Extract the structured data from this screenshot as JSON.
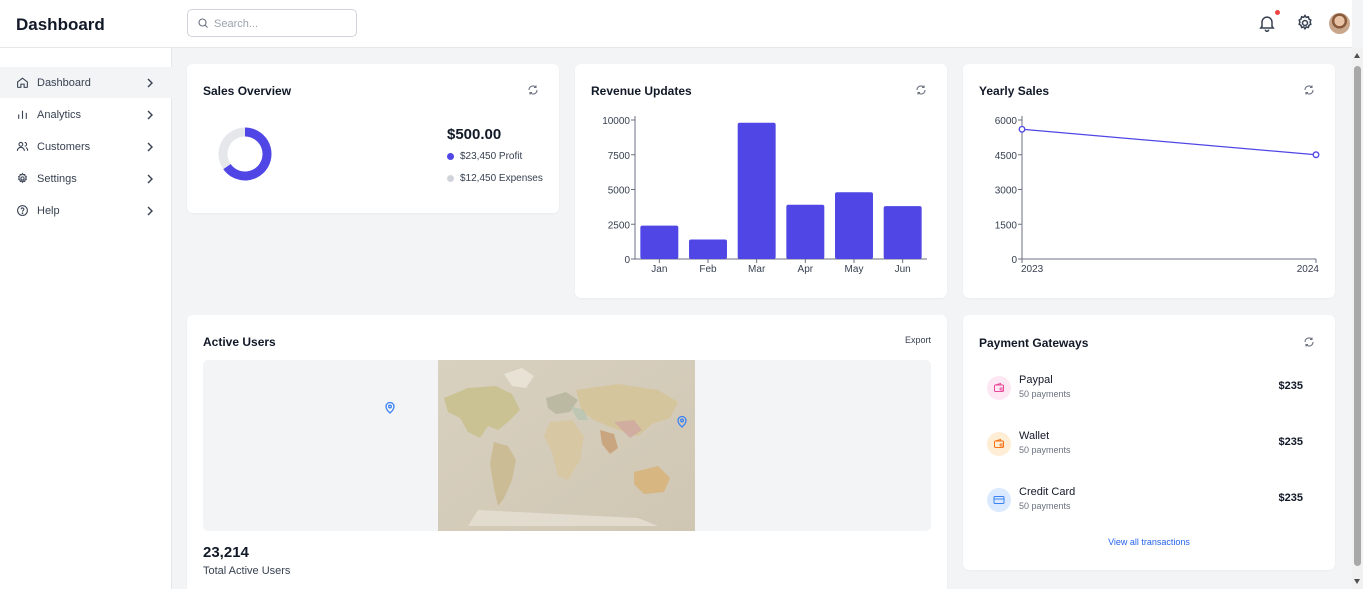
{
  "header": {
    "title": "Dashboard",
    "search_placeholder": "Search..."
  },
  "sidebar": {
    "items": [
      {
        "label": "Dashboard",
        "icon": "home-icon",
        "active": true
      },
      {
        "label": "Analytics",
        "icon": "bar-chart-icon"
      },
      {
        "label": "Customers",
        "icon": "users-icon"
      },
      {
        "label": "Settings",
        "icon": "gear-icon"
      },
      {
        "label": "Help",
        "icon": "help-circle-icon"
      }
    ]
  },
  "colors": {
    "accent": "#4f46e5",
    "profit": "#4f46e5",
    "expenses": "#e5e7eb",
    "notification_dot": "#ef4444",
    "link": "#2563eb"
  },
  "sales_overview": {
    "title": "Sales Overview",
    "amount": "$500.00",
    "profit_label": "$23,450 Profit",
    "expenses_label": "$12,450 Expenses"
  },
  "revenue_updates": {
    "title": "Revenue Updates"
  },
  "yearly_sales": {
    "title": "Yearly Sales"
  },
  "active_users": {
    "title": "Active Users",
    "export_label": "Export",
    "count": "23,214",
    "count_label": "Total Active Users"
  },
  "payment_gateways": {
    "title": "Payment Gateways",
    "items": [
      {
        "name": "Paypal",
        "sub": "50 payments",
        "amount": "$235",
        "icon": "wallet-icon",
        "icon_color": "#ec4899",
        "bg_color": "#fce7f3"
      },
      {
        "name": "Wallet",
        "sub": "50 payments",
        "amount": "$235",
        "icon": "wallet-icon",
        "icon_color": "#f97316",
        "bg_color": "#ffedd5"
      },
      {
        "name": "Credit Card",
        "sub": "50 payments",
        "amount": "$235",
        "icon": "credit-card-icon",
        "icon_color": "#3b82f6",
        "bg_color": "#dbeafe"
      }
    ],
    "view_all": "View all transactions"
  },
  "chart_data": [
    {
      "type": "pie",
      "title": "Sales Overview",
      "donut": true,
      "labels": [
        "Profit",
        "Expenses"
      ],
      "values": [
        23450,
        12450
      ],
      "colors": [
        "#4f46e5",
        "#e5e7eb"
      ]
    },
    {
      "type": "bar",
      "title": "Revenue Updates",
      "categories": [
        "Jan",
        "Feb",
        "Mar",
        "Apr",
        "May",
        "Jun"
      ],
      "values": [
        2400,
        1400,
        9800,
        3900,
        4800,
        3800
      ],
      "ylim": [
        0,
        10000
      ],
      "yticks": [
        0,
        2500,
        5000,
        7500,
        10000
      ],
      "color": "#4f46e5",
      "grid": false
    },
    {
      "type": "line",
      "title": "Yearly Sales",
      "x": [
        "2023",
        "2024"
      ],
      "values": [
        5600,
        4500
      ],
      "ylim": [
        0,
        6000
      ],
      "yticks": [
        0,
        1500,
        3000,
        4500,
        6000
      ],
      "color": "#4f46e5",
      "grid": false
    }
  ]
}
